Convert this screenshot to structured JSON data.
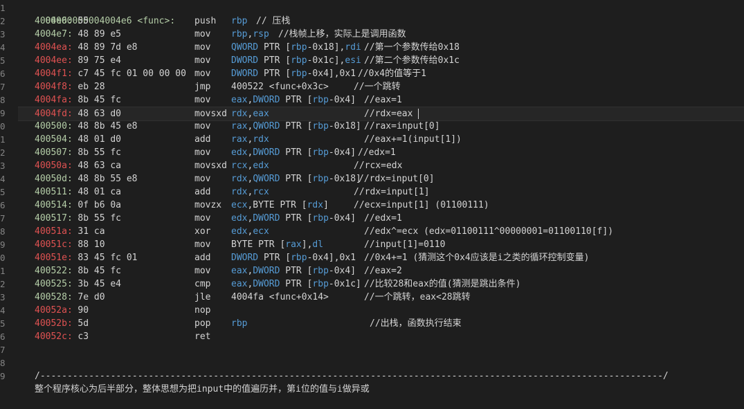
{
  "header": "00000000004004e6 <func>:",
  "line_numbers": [
    "1",
    "2",
    "3",
    "4",
    "5",
    "6",
    "7",
    "8",
    "9",
    "0",
    "1",
    "2",
    "3",
    "4",
    "5",
    "6",
    "7",
    "8",
    "9",
    "0",
    "1",
    "2",
    "3",
    "4",
    "5",
    "6",
    "7",
    "8",
    "9"
  ],
  "lines": [
    {
      "addr": "4004e6:",
      "hex": "55",
      "color": "green",
      "mn": "push",
      "ops": [
        {
          "t": "rbp",
          "c": "reg"
        }
      ],
      "cm": "// 压栈",
      "cmx": 370
    },
    {
      "addr": "4004e7:",
      "hex": "48 89 e5",
      "color": "green",
      "mn": "mov",
      "ops": [
        {
          "t": "rbp",
          "c": "reg"
        },
        {
          "t": ",",
          "c": "op"
        },
        {
          "t": "rsp",
          "c": "reg"
        }
      ],
      "cm": "//栈帧上移，实际上是调用函数",
      "cmx": 402
    },
    {
      "addr": "4004ea:",
      "hex": "48 89 7d e8",
      "color": "red",
      "mn": "mov",
      "ops": [
        {
          "t": "QWORD",
          "c": "reg"
        },
        {
          "t": " PTR [",
          "c": "op"
        },
        {
          "t": "rbp",
          "c": "reg"
        },
        {
          "t": "-0x18],",
          "c": "op"
        },
        {
          "t": "rdi",
          "c": "reg"
        }
      ],
      "cm": "//第一个参数传给0x18",
      "cmx": 526
    },
    {
      "addr": "4004ee:",
      "hex": "89 75 e4",
      "color": "red",
      "mn": "mov",
      "ops": [
        {
          "t": "DWORD",
          "c": "reg"
        },
        {
          "t": " PTR [",
          "c": "op"
        },
        {
          "t": "rbp",
          "c": "reg"
        },
        {
          "t": "-0x1c],",
          "c": "op"
        },
        {
          "t": "esi",
          "c": "reg"
        }
      ],
      "cm": "//第二个参数传给0x1c",
      "cmx": 526
    },
    {
      "addr": "4004f1:",
      "hex": "c7 45 fc 01 00 00 00",
      "color": "red",
      "mn": "mov",
      "ops": [
        {
          "t": "DWORD",
          "c": "reg"
        },
        {
          "t": " PTR [",
          "c": "op"
        },
        {
          "t": "rbp",
          "c": "reg"
        },
        {
          "t": "-0x4],0x1",
          "c": "op"
        }
      ],
      "cm": "//0x4的值等于1",
      "cmx": 517
    },
    {
      "addr": "4004f8:",
      "hex": "eb 28",
      "color": "red",
      "mn": "jmp",
      "ops": [
        {
          "t": "400522 <func+0x3c>",
          "c": "op"
        }
      ],
      "cm": "//一个跳转",
      "cmx": 511
    },
    {
      "addr": "4004fa:",
      "hex": "8b 45 fc",
      "color": "red",
      "mn": "mov",
      "ops": [
        {
          "t": "eax",
          "c": "reg"
        },
        {
          "t": ",",
          "c": "op"
        },
        {
          "t": "DWORD",
          "c": "reg"
        },
        {
          "t": " PTR [",
          "c": "op"
        },
        {
          "t": "rbp",
          "c": "reg"
        },
        {
          "t": "-0x4]",
          "c": "op"
        }
      ],
      "cm": "//eax=1",
      "cmx": 526
    },
    {
      "addr": "4004fd:",
      "hex": "48 63 d0",
      "color": "red",
      "mn": "movsxd",
      "ops": [
        {
          "t": "rdx",
          "c": "reg"
        },
        {
          "t": ",",
          "c": "op"
        },
        {
          "t": "eax",
          "c": "reg"
        }
      ],
      "cm": "//rdx=eax",
      "cmx": 526,
      "cursor": true
    },
    {
      "addr": "400500:",
      "hex": "48 8b 45 e8",
      "color": "green",
      "mn": "mov",
      "ops": [
        {
          "t": "rax",
          "c": "reg"
        },
        {
          "t": ",",
          "c": "op"
        },
        {
          "t": "QWORD",
          "c": "reg"
        },
        {
          "t": " PTR [",
          "c": "op"
        },
        {
          "t": "rbp",
          "c": "reg"
        },
        {
          "t": "-0x18]",
          "c": "op"
        }
      ],
      "cm": "//rax=input[0]",
      "cmx": 526
    },
    {
      "addr": "400504:",
      "hex": "48 01 d0",
      "color": "green",
      "mn": "add",
      "ops": [
        {
          "t": "rax",
          "c": "reg"
        },
        {
          "t": ",",
          "c": "op"
        },
        {
          "t": "rdx",
          "c": "reg"
        }
      ],
      "cm": "//eax+=1(input[1])",
      "cmx": 526
    },
    {
      "addr": "400507:",
      "hex": "8b 55 fc",
      "color": "green",
      "mn": "mov",
      "ops": [
        {
          "t": "edx",
          "c": "reg"
        },
        {
          "t": ",",
          "c": "op"
        },
        {
          "t": "DWORD",
          "c": "reg"
        },
        {
          "t": " PTR [",
          "c": "op"
        },
        {
          "t": "rbp",
          "c": "reg"
        },
        {
          "t": "-0x4]",
          "c": "op"
        }
      ],
      "cm": "//edx=1",
      "cmx": 517
    },
    {
      "addr": "40050a:",
      "hex": "48 63 ca",
      "color": "red",
      "mn": "movsxd",
      "ops": [
        {
          "t": "rcx",
          "c": "reg"
        },
        {
          "t": ",",
          "c": "op"
        },
        {
          "t": "edx",
          "c": "reg"
        }
      ],
      "cm": "//rcx=edx",
      "cmx": 511
    },
    {
      "addr": "40050d:",
      "hex": "48 8b 55 e8",
      "color": "green",
      "mn": "mov",
      "ops": [
        {
          "t": "rdx",
          "c": "reg"
        },
        {
          "t": ",",
          "c": "op"
        },
        {
          "t": "QWORD",
          "c": "reg"
        },
        {
          "t": " PTR [",
          "c": "op"
        },
        {
          "t": "rbp",
          "c": "reg"
        },
        {
          "t": "-0x18]",
          "c": "op"
        }
      ],
      "cm": "//rdx=input[0]",
      "cmx": 518
    },
    {
      "addr": "400511:",
      "hex": "48 01 ca",
      "color": "green",
      "mn": "add",
      "ops": [
        {
          "t": "rdx",
          "c": "reg"
        },
        {
          "t": ",",
          "c": "op"
        },
        {
          "t": "rcx",
          "c": "reg"
        }
      ],
      "cm": "//rdx=input[1]",
      "cmx": 511
    },
    {
      "addr": "400514:",
      "hex": "0f b6 0a",
      "color": "green",
      "mn": "movzx",
      "ops": [
        {
          "t": "ecx",
          "c": "reg"
        },
        {
          "t": ",BYTE PTR [",
          "c": "op"
        },
        {
          "t": "rdx",
          "c": "reg"
        },
        {
          "t": "]",
          "c": "op"
        }
      ],
      "cm": "//ecx=input[1] (01100111)",
      "cmx": 511
    },
    {
      "addr": "400517:",
      "hex": "8b 55 fc",
      "color": "green",
      "mn": "mov",
      "ops": [
        {
          "t": "edx",
          "c": "reg"
        },
        {
          "t": ",",
          "c": "op"
        },
        {
          "t": "DWORD",
          "c": "reg"
        },
        {
          "t": " PTR [",
          "c": "op"
        },
        {
          "t": "rbp",
          "c": "reg"
        },
        {
          "t": "-0x4]",
          "c": "op"
        }
      ],
      "cm": "//edx=1",
      "cmx": 526
    },
    {
      "addr": "40051a:",
      "hex": "31 ca",
      "color": "red",
      "mn": "xor",
      "ops": [
        {
          "t": "edx",
          "c": "reg"
        },
        {
          "t": ",",
          "c": "op"
        },
        {
          "t": "ecx",
          "c": "reg"
        }
      ],
      "cm": "//edx^=ecx (edx=01100111^00000001=01100110[f])",
      "cmx": 526
    },
    {
      "addr": "40051c:",
      "hex": "88 10",
      "color": "red",
      "mn": "mov",
      "ops": [
        {
          "t": "BYTE PTR [",
          "c": "op"
        },
        {
          "t": "rax",
          "c": "reg"
        },
        {
          "t": "],",
          "c": "op"
        },
        {
          "t": "dl",
          "c": "reg"
        }
      ],
      "cm": "//input[1]=0110",
      "cmx": 526
    },
    {
      "addr": "40051e:",
      "hex": "83 45 fc 01",
      "color": "red",
      "mn": "add",
      "ops": [
        {
          "t": "DWORD",
          "c": "reg"
        },
        {
          "t": " PTR [",
          "c": "op"
        },
        {
          "t": "rbp",
          "c": "reg"
        },
        {
          "t": "-0x4],0x1",
          "c": "op"
        }
      ],
      "cm": "//0x4+=1 (猜测这个0x4应该是i之类的循环控制变量)",
      "cmx": 526
    },
    {
      "addr": "400522:",
      "hex": "8b 45 fc",
      "color": "green",
      "mn": "mov",
      "ops": [
        {
          "t": "eax",
          "c": "reg"
        },
        {
          "t": ",",
          "c": "op"
        },
        {
          "t": "DWORD",
          "c": "reg"
        },
        {
          "t": " PTR [",
          "c": "op"
        },
        {
          "t": "rbp",
          "c": "reg"
        },
        {
          "t": "-0x4]",
          "c": "op"
        }
      ],
      "cm": "//eax=2",
      "cmx": 526
    },
    {
      "addr": "400525:",
      "hex": "3b 45 e4",
      "color": "green",
      "mn": "cmp",
      "ops": [
        {
          "t": "eax",
          "c": "reg"
        },
        {
          "t": ",",
          "c": "op"
        },
        {
          "t": "DWORD",
          "c": "reg"
        },
        {
          "t": " PTR [",
          "c": "op"
        },
        {
          "t": "rbp",
          "c": "reg"
        },
        {
          "t": "-0x1c]",
          "c": "op"
        }
      ],
      "cm": "//比较28和eax的值(猜测是跳出条件)",
      "cmx": 526
    },
    {
      "addr": "400528:",
      "hex": "7e d0",
      "color": "green",
      "mn": "jle",
      "ops": [
        {
          "t": "4004fa <func+0x14>",
          "c": "op"
        }
      ],
      "cm": "//一个跳转，eax<28跳转",
      "cmx": 526
    },
    {
      "addr": "40052a:",
      "hex": "90",
      "color": "red",
      "mn": "nop",
      "ops": [],
      "cm": "",
      "cmx": 0
    },
    {
      "addr": "40052b:",
      "hex": "5d",
      "color": "red",
      "mn": "pop",
      "ops": [
        {
          "t": "rbp",
          "c": "reg"
        }
      ],
      "cm": "//出栈，函数执行结束",
      "cmx": 534
    },
    {
      "addr": "40052c:",
      "hex": "c3",
      "color": "red",
      "mn": "ret",
      "ops": [],
      "cm": "",
      "cmx": 0
    }
  ],
  "separator": "/-------------------------------------------------------------------------------------------------------------------/",
  "summary": "整个程序核心为后半部分，整体思想为把input中的值遍历并，第i位的值与i做异或"
}
